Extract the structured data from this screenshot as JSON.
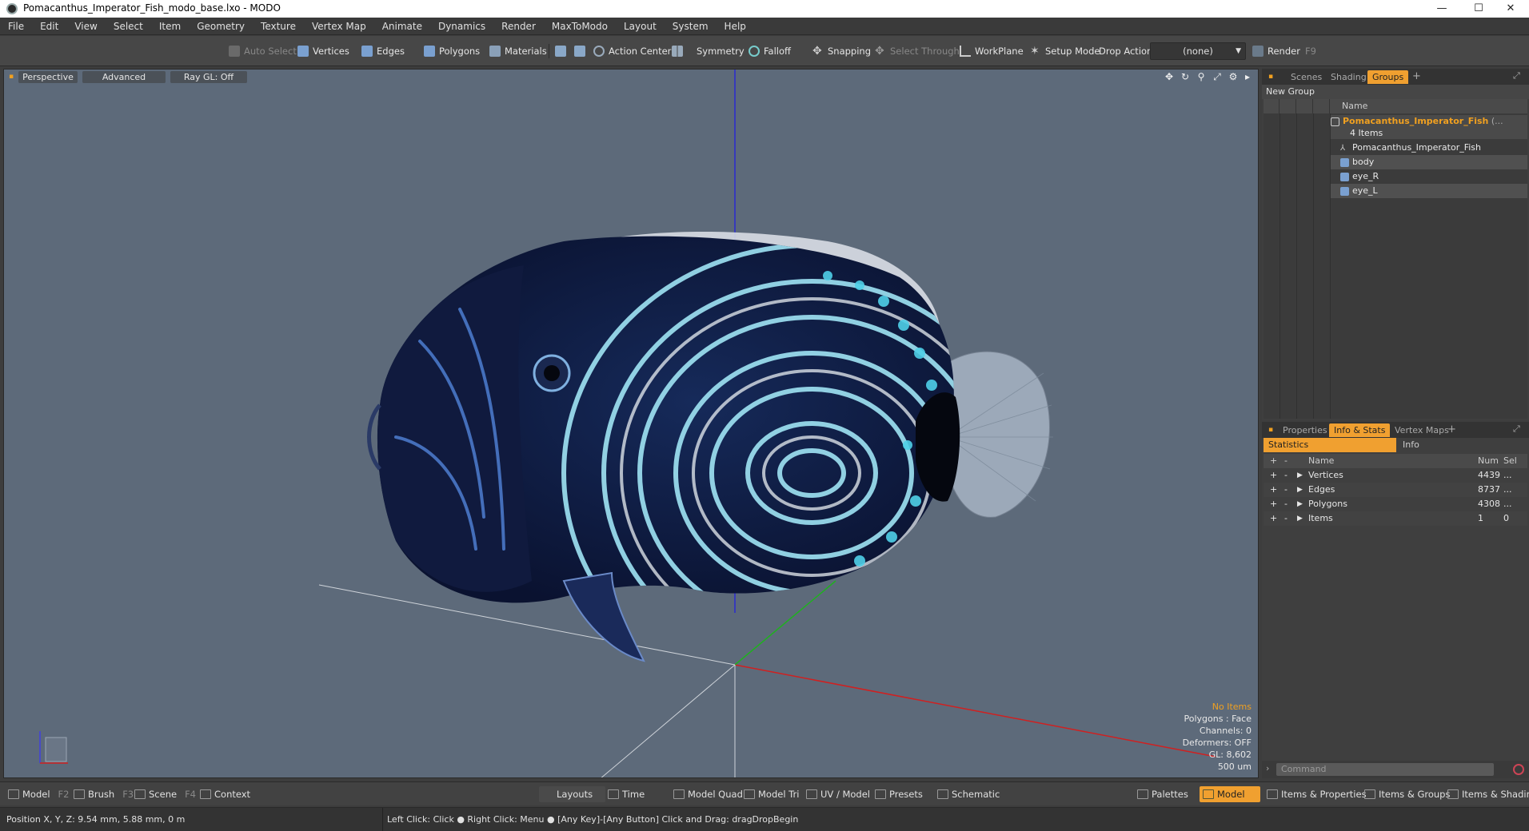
{
  "window": {
    "title": "Pomacanthus_Imperator_Fish_modo_base.lxo - MODO",
    "min": "—",
    "max": "☐",
    "close": "✕"
  },
  "menu": [
    "File",
    "Edit",
    "View",
    "Select",
    "Item",
    "Geometry",
    "Texture",
    "Vertex Map",
    "Animate",
    "Dynamics",
    "Render",
    "MaxToModo",
    "Layout",
    "System",
    "Help"
  ],
  "toolbar": {
    "auto_select": "Auto Select",
    "vertices": "Vertices",
    "edges": "Edges",
    "polygons": "Polygons",
    "materials": "Materials",
    "action_center": "Action Center",
    "symmetry": "Symmetry",
    "falloff": "Falloff",
    "snapping": "Snapping",
    "select_through": "Select Through",
    "workplane": "WorkPlane",
    "setup_mode": "Setup Mode",
    "drop_action": "Drop Action",
    "drop_value": "(none)",
    "render": "Render",
    "render_key": "F9"
  },
  "viewport": {
    "tabs": [
      "Perspective",
      "Advanced",
      "Ray GL: Off"
    ],
    "stats": {
      "no_items": "No Items",
      "polygons": "Polygons : Face",
      "channels": "Channels: 0",
      "deformers": "Deformers: OFF",
      "gl": "GL: 8,602",
      "scale": "500 um"
    },
    "colors": {
      "background": "#5d6a7a",
      "x_axis": "#d02020",
      "y_axis": "#2020c0",
      "z_axis": "#20b020",
      "fish_dark": "#0e1636",
      "fish_stripe": "#8fe0f0"
    }
  },
  "groups_panel": {
    "tabs": [
      "Scenes",
      "Shading",
      "Groups"
    ],
    "new_group": "New Group",
    "name_col": "Name",
    "root": "Pomacanthus_Imperator_Fish",
    "root_suffix": "(...",
    "root_count": "4 Items",
    "children": [
      "Pomacanthus_Imperator_Fish",
      "body",
      "eye_R",
      "eye_L"
    ]
  },
  "info_panel": {
    "tabs": [
      "Properties",
      "Info & Stats",
      "Vertex Maps"
    ],
    "sub_tabs": [
      "Statistics",
      "Info"
    ],
    "headers": {
      "plus": "+",
      "minus": "-",
      "name": "Name",
      "num": "Num",
      "sel": "Sel"
    },
    "rows": [
      {
        "name": "Vertices",
        "num": "4439",
        "sel": "..."
      },
      {
        "name": "Edges",
        "num": "8737",
        "sel": "..."
      },
      {
        "name": "Polygons",
        "num": "4308",
        "sel": "..."
      },
      {
        "name": "Items",
        "num": "1",
        "sel": "0"
      }
    ],
    "command_placeholder": "Command"
  },
  "bottom": {
    "model": "Model",
    "model_key": "F2",
    "brush": "Brush",
    "brush_key": "F3",
    "scene": "Scene",
    "scene_key": "F4",
    "context": "Context",
    "layouts": "Layouts",
    "time": "Time",
    "model_quad": "Model Quad",
    "model_tri": "Model Tri",
    "uv_model": "UV / Model",
    "presets": "Presets",
    "schematic": "Schematic",
    "palettes": "Palettes",
    "model_active": "Model",
    "items_properties": "Items & Properties",
    "items_groups": "Items & Groups",
    "items_shading": "Items & Shading"
  },
  "status": {
    "position": "Position X, Y, Z:  9.54 mm, 5.88 mm, 0 m",
    "hint": "Left Click: Click ● Right Click: Menu ● [Any Key]-[Any Button] Click and Drag: dragDropBegin"
  }
}
